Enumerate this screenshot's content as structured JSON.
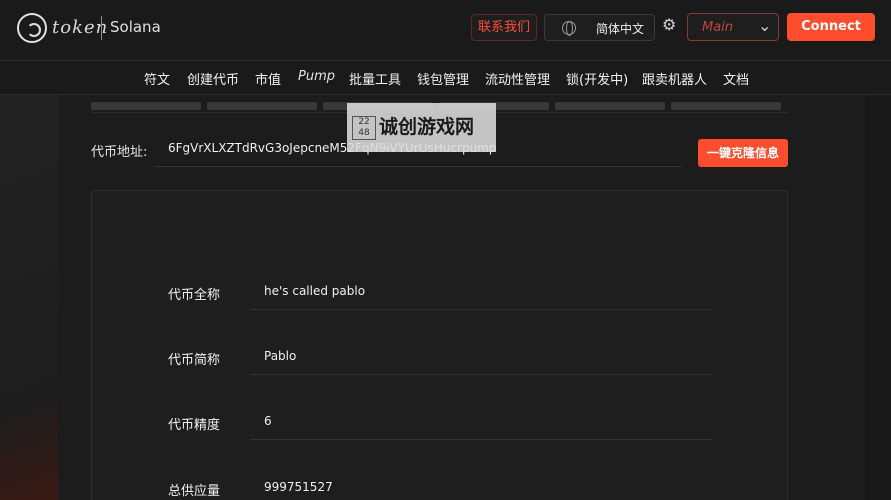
{
  "header": {
    "logo_word": "token",
    "chain": "Solana",
    "contact_button": "联系我们",
    "language": "简体中文",
    "network": "Main",
    "connect_button": "Connect"
  },
  "nav": {
    "items": [
      "符文",
      "创建代币",
      "市值",
      "Pump",
      "批量工具",
      "钱包管理",
      "流动性管理",
      "锁(开发中)",
      "跟卖机器人",
      "文档"
    ]
  },
  "address": {
    "label": "代币地址:",
    "value": "6FgVrXLXZTdRvG3oJepcneM52FqN9iVYUrUsHucrpump"
  },
  "clone_button": "一键克隆信息",
  "watermark": {
    "icon": "22\n48",
    "text": "诚创游戏网"
  },
  "token_info": [
    {
      "label": "代币全称",
      "value": "he's called pablo"
    },
    {
      "label": "代币简称",
      "value": "Pablo"
    },
    {
      "label": "代币精度",
      "value": "6"
    },
    {
      "label": "总供应量",
      "value": "999751527"
    }
  ]
}
